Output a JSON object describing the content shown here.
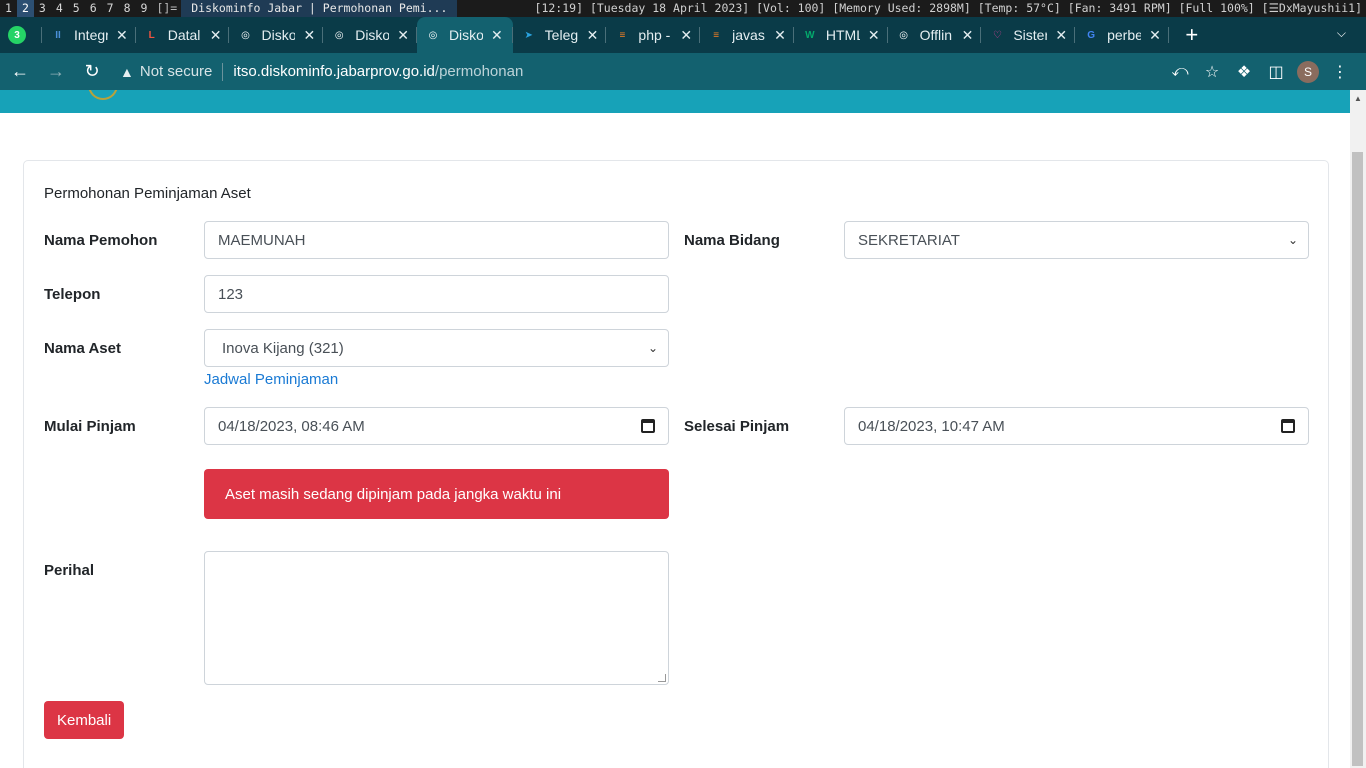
{
  "wm": {
    "workspaces": [
      "1",
      "2",
      "3",
      "4",
      "5",
      "6",
      "7",
      "8",
      "9"
    ],
    "active_workspace": "2",
    "layout": "[]=",
    "window_title": "Diskominfo Jabar | Permohonan Pemi...",
    "time": "[12:19]",
    "date": "[Tuesday 18 April 2023]",
    "vol": "[Vol: 100]",
    "memory": "[Memory Used: 2898M]",
    "temp": "[Temp: 57°C]",
    "fan": "[Fan: 3491 RPM]",
    "battery": "[Full 100%]",
    "user": "[☰DxMayushii1]"
  },
  "tabs": [
    {
      "label": "",
      "icon": "whatsapp-icon",
      "favicon": "3",
      "color": "#25d366"
    },
    {
      "label": "Integr",
      "icon": "integration-icon",
      "favicon": "II",
      "color": "#4a90d9"
    },
    {
      "label": "Datal",
      "icon": "laravel-icon",
      "favicon": "L",
      "color": "#f05340"
    },
    {
      "label": "Disko",
      "icon": "globe-icon",
      "favicon": "◎",
      "color": "#ffffff"
    },
    {
      "label": "Disko",
      "icon": "globe-icon",
      "favicon": "◎",
      "color": "#ffffff"
    },
    {
      "label": "Disko",
      "icon": "globe-icon",
      "favicon": "◎",
      "color": "#ffffff",
      "active": true
    },
    {
      "label": "Teleg",
      "icon": "telegram-icon",
      "favicon": "➤",
      "color": "#2aa3df"
    },
    {
      "label": "php -",
      "icon": "stackoverflow-icon",
      "favicon": "≡",
      "color": "#f48024"
    },
    {
      "label": "javas",
      "icon": "stackoverflow-icon",
      "favicon": "≡",
      "color": "#f48024"
    },
    {
      "label": "HTML",
      "icon": "w3schools-icon",
      "favicon": "W",
      "color": "#04aa6d"
    },
    {
      "label": "Offlin",
      "icon": "globe-icon",
      "favicon": "◎",
      "color": "#ffffff"
    },
    {
      "label": "Sister",
      "icon": "heart-icon",
      "favicon": "♡",
      "color": "#e0409a"
    },
    {
      "label": "perbe",
      "icon": "google-icon",
      "favicon": "G",
      "color": "#4285f4"
    }
  ],
  "address_bar": {
    "security": "Not secure",
    "domain": "itso.diskominfo.jabarprov.go.id",
    "path": "/permohonan",
    "profile_initial": "S"
  },
  "form": {
    "title": "Permohonan Peminjaman Aset",
    "nama_pemohon_label": "Nama Pemohon",
    "nama_pemohon_value": "MAEMUNAH",
    "nama_bidang_label": "Nama Bidang",
    "nama_bidang_value": "SEKRETARIAT",
    "telepon_label": "Telepon",
    "telepon_value": "123",
    "nama_aset_label": "Nama Aset",
    "nama_aset_value": "Inova Kijang (321)",
    "jadwal_link": "Jadwal Peminjaman",
    "mulai_label": "Mulai Pinjam",
    "mulai_value": "04/18/2023, 08:46 AM",
    "selesai_label": "Selesai Pinjam",
    "selesai_value": "04/18/2023, 10:47 AM",
    "alert": "Aset masih sedang dipinjam pada jangka waktu ini",
    "perihal_label": "Perihal",
    "perihal_value": "",
    "back_button": "Kembali"
  }
}
